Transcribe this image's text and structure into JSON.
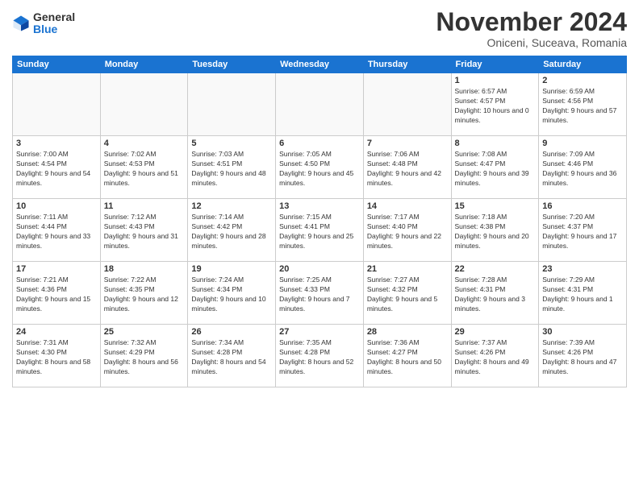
{
  "logo": {
    "general": "General",
    "blue": "Blue"
  },
  "title": "November 2024",
  "location": "Oniceni, Suceava, Romania",
  "days_of_week": [
    "Sunday",
    "Monday",
    "Tuesday",
    "Wednesday",
    "Thursday",
    "Friday",
    "Saturday"
  ],
  "weeks": [
    [
      {
        "day": "",
        "info": ""
      },
      {
        "day": "",
        "info": ""
      },
      {
        "day": "",
        "info": ""
      },
      {
        "day": "",
        "info": ""
      },
      {
        "day": "",
        "info": ""
      },
      {
        "day": "1",
        "info": "Sunrise: 6:57 AM\nSunset: 4:57 PM\nDaylight: 10 hours and 0 minutes."
      },
      {
        "day": "2",
        "info": "Sunrise: 6:59 AM\nSunset: 4:56 PM\nDaylight: 9 hours and 57 minutes."
      }
    ],
    [
      {
        "day": "3",
        "info": "Sunrise: 7:00 AM\nSunset: 4:54 PM\nDaylight: 9 hours and 54 minutes."
      },
      {
        "day": "4",
        "info": "Sunrise: 7:02 AM\nSunset: 4:53 PM\nDaylight: 9 hours and 51 minutes."
      },
      {
        "day": "5",
        "info": "Sunrise: 7:03 AM\nSunset: 4:51 PM\nDaylight: 9 hours and 48 minutes."
      },
      {
        "day": "6",
        "info": "Sunrise: 7:05 AM\nSunset: 4:50 PM\nDaylight: 9 hours and 45 minutes."
      },
      {
        "day": "7",
        "info": "Sunrise: 7:06 AM\nSunset: 4:48 PM\nDaylight: 9 hours and 42 minutes."
      },
      {
        "day": "8",
        "info": "Sunrise: 7:08 AM\nSunset: 4:47 PM\nDaylight: 9 hours and 39 minutes."
      },
      {
        "day": "9",
        "info": "Sunrise: 7:09 AM\nSunset: 4:46 PM\nDaylight: 9 hours and 36 minutes."
      }
    ],
    [
      {
        "day": "10",
        "info": "Sunrise: 7:11 AM\nSunset: 4:44 PM\nDaylight: 9 hours and 33 minutes."
      },
      {
        "day": "11",
        "info": "Sunrise: 7:12 AM\nSunset: 4:43 PM\nDaylight: 9 hours and 31 minutes."
      },
      {
        "day": "12",
        "info": "Sunrise: 7:14 AM\nSunset: 4:42 PM\nDaylight: 9 hours and 28 minutes."
      },
      {
        "day": "13",
        "info": "Sunrise: 7:15 AM\nSunset: 4:41 PM\nDaylight: 9 hours and 25 minutes."
      },
      {
        "day": "14",
        "info": "Sunrise: 7:17 AM\nSunset: 4:40 PM\nDaylight: 9 hours and 22 minutes."
      },
      {
        "day": "15",
        "info": "Sunrise: 7:18 AM\nSunset: 4:38 PM\nDaylight: 9 hours and 20 minutes."
      },
      {
        "day": "16",
        "info": "Sunrise: 7:20 AM\nSunset: 4:37 PM\nDaylight: 9 hours and 17 minutes."
      }
    ],
    [
      {
        "day": "17",
        "info": "Sunrise: 7:21 AM\nSunset: 4:36 PM\nDaylight: 9 hours and 15 minutes."
      },
      {
        "day": "18",
        "info": "Sunrise: 7:22 AM\nSunset: 4:35 PM\nDaylight: 9 hours and 12 minutes."
      },
      {
        "day": "19",
        "info": "Sunrise: 7:24 AM\nSunset: 4:34 PM\nDaylight: 9 hours and 10 minutes."
      },
      {
        "day": "20",
        "info": "Sunrise: 7:25 AM\nSunset: 4:33 PM\nDaylight: 9 hours and 7 minutes."
      },
      {
        "day": "21",
        "info": "Sunrise: 7:27 AM\nSunset: 4:32 PM\nDaylight: 9 hours and 5 minutes."
      },
      {
        "day": "22",
        "info": "Sunrise: 7:28 AM\nSunset: 4:31 PM\nDaylight: 9 hours and 3 minutes."
      },
      {
        "day": "23",
        "info": "Sunrise: 7:29 AM\nSunset: 4:31 PM\nDaylight: 9 hours and 1 minute."
      }
    ],
    [
      {
        "day": "24",
        "info": "Sunrise: 7:31 AM\nSunset: 4:30 PM\nDaylight: 8 hours and 58 minutes."
      },
      {
        "day": "25",
        "info": "Sunrise: 7:32 AM\nSunset: 4:29 PM\nDaylight: 8 hours and 56 minutes."
      },
      {
        "day": "26",
        "info": "Sunrise: 7:34 AM\nSunset: 4:28 PM\nDaylight: 8 hours and 54 minutes."
      },
      {
        "day": "27",
        "info": "Sunrise: 7:35 AM\nSunset: 4:28 PM\nDaylight: 8 hours and 52 minutes."
      },
      {
        "day": "28",
        "info": "Sunrise: 7:36 AM\nSunset: 4:27 PM\nDaylight: 8 hours and 50 minutes."
      },
      {
        "day": "29",
        "info": "Sunrise: 7:37 AM\nSunset: 4:26 PM\nDaylight: 8 hours and 49 minutes."
      },
      {
        "day": "30",
        "info": "Sunrise: 7:39 AM\nSunset: 4:26 PM\nDaylight: 8 hours and 47 minutes."
      }
    ]
  ]
}
